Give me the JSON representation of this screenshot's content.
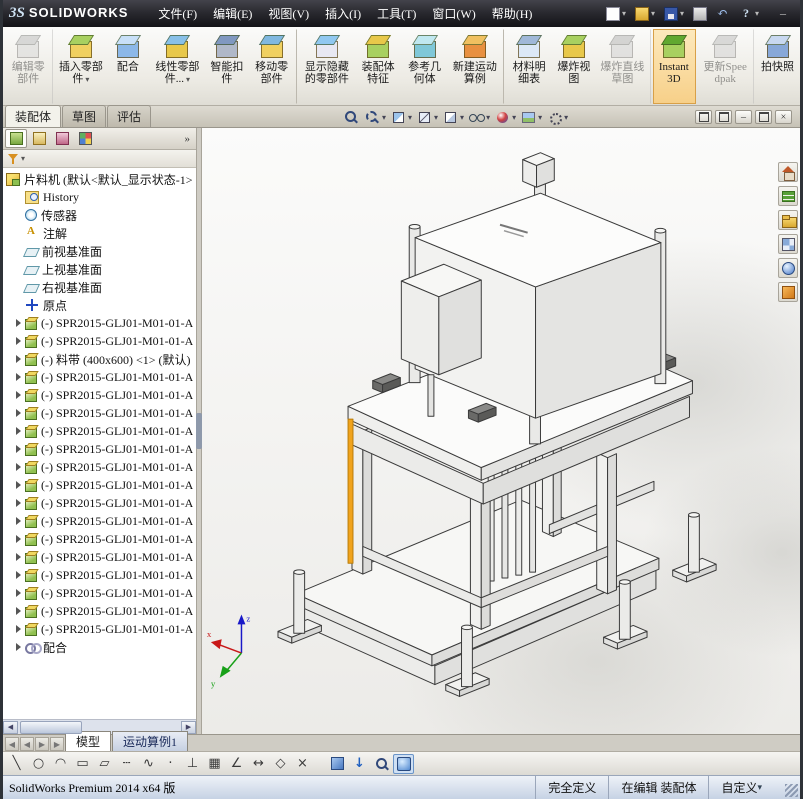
{
  "titlebar": {
    "logo_mark": "3S",
    "logo_text": "SOLIDWORKS",
    "menus": [
      "文件(F)",
      "编辑(E)",
      "视图(V)",
      "插入(I)",
      "工具(T)",
      "窗口(W)",
      "帮助(H)"
    ],
    "quick_icons": [
      {
        "icon": "new-document",
        "dropdown": true
      },
      {
        "icon": "open",
        "dropdown": true
      },
      {
        "icon": "save",
        "dropdown": true
      },
      {
        "icon": "print"
      },
      {
        "icon": "undo"
      },
      {
        "icon": "help",
        "dropdown": true
      }
    ],
    "window_dash": "–"
  },
  "ribbon": {
    "buttons": [
      {
        "label": "编辑零部件",
        "icon": "edit-component",
        "disabled": true,
        "sep": true
      },
      {
        "label": "插入零部件",
        "icon": "insert-component",
        "dropdown": true
      },
      {
        "label": "配合",
        "icon": "mate"
      },
      {
        "label": "线性零部件...",
        "icon": "linear-pattern",
        "dropdown": true
      },
      {
        "label": "智能扣件",
        "icon": "smart-fastener"
      },
      {
        "label": "移动零部件",
        "icon": "move-component",
        "sep": true
      },
      {
        "label": "显示隐藏的零部件",
        "icon": "show-hidden"
      },
      {
        "label": "装配体特征",
        "icon": "assembly-features"
      },
      {
        "label": "参考几何体",
        "icon": "reference-geometry"
      },
      {
        "label": "新建运动算例",
        "icon": "motion-study",
        "sep": true
      },
      {
        "label": "材料明细表",
        "icon": "bom"
      },
      {
        "label": "爆炸视图",
        "icon": "exploded-view"
      },
      {
        "label": "爆炸直线草图",
        "icon": "explode-sketch",
        "disabled": true,
        "sep": true
      },
      {
        "label": "Instant3D",
        "icon": "instant3d",
        "active": true,
        "sep": true
      },
      {
        "label": "更新Speedpak",
        "icon": "update-speedpak",
        "disabled": true,
        "sep": true
      },
      {
        "label": "拍快照",
        "icon": "snapshot"
      }
    ]
  },
  "doc_tabs": {
    "items": [
      {
        "label": "装配体",
        "active": true
      },
      {
        "label": "草图"
      },
      {
        "label": "评估"
      }
    ]
  },
  "view_toolbar": {
    "icons": [
      {
        "icon": "zoom-fit"
      },
      {
        "icon": "zoom-area",
        "dropdown": true
      },
      {
        "icon": "section-view",
        "dropdown": true
      },
      {
        "icon": "view-orientation",
        "dropdown": true
      },
      {
        "icon": "display-style",
        "dropdown": true
      },
      {
        "icon": "hide-show-items",
        "dropdown": true
      },
      {
        "icon": "edit-appearance",
        "dropdown": true
      },
      {
        "icon": "apply-scene",
        "dropdown": true
      },
      {
        "icon": "view-settings",
        "dropdown": true
      }
    ]
  },
  "child_window": {
    "controls": [
      {
        "icon": "window-restore",
        "box": true
      },
      {
        "icon": "window-float",
        "box": true
      },
      {
        "icon": "window-minimize",
        "glyph": "–"
      },
      {
        "icon": "window-maximize",
        "box": true
      },
      {
        "icon": "window-close",
        "glyph": "×"
      }
    ]
  },
  "panel": {
    "tabs": [
      {
        "icon": "feature-manager",
        "active": true
      },
      {
        "icon": "property-manager"
      },
      {
        "icon": "configuration-manager"
      },
      {
        "icon": "display-manager"
      }
    ],
    "overflow_glyph": "»",
    "filter_caret": "▾"
  },
  "tree": {
    "root": {
      "icon": "assembly",
      "label": "片料机 (默认<默认_显示状态-1>"
    },
    "items": [
      {
        "icon": "history",
        "label": "History"
      },
      {
        "icon": "sensors",
        "label": "传感器"
      },
      {
        "icon": "annotations",
        "label": "注解"
      },
      {
        "icon": "plane",
        "label": "前视基准面"
      },
      {
        "icon": "plane",
        "label": "上视基准面"
      },
      {
        "icon": "plane",
        "label": "右视基准面"
      },
      {
        "icon": "origin",
        "label": "原点"
      },
      {
        "icon": "component",
        "label": "(-) SPR2015-GLJ01-M01-01-A",
        "expand": true
      },
      {
        "icon": "component",
        "label": "(-) SPR2015-GLJ01-M01-01-A",
        "expand": true
      },
      {
        "icon": "component",
        "label": "(-) 料带 (400x600) <1> (默认)",
        "expand": true
      },
      {
        "icon": "component",
        "label": "(-) SPR2015-GLJ01-M01-01-A",
        "expand": true
      },
      {
        "icon": "component",
        "label": "(-) SPR2015-GLJ01-M01-01-A",
        "expand": true
      },
      {
        "icon": "component",
        "label": "(-) SPR2015-GLJ01-M01-01-A",
        "expand": true
      },
      {
        "icon": "component",
        "label": "(-) SPR2015-GLJ01-M01-01-A",
        "expand": true
      },
      {
        "icon": "component",
        "label": "(-) SPR2015-GLJ01-M01-01-A",
        "expand": true
      },
      {
        "icon": "component",
        "label": "(-) SPR2015-GLJ01-M01-01-A",
        "expand": true
      },
      {
        "icon": "component",
        "label": "(-) SPR2015-GLJ01-M01-01-A",
        "expand": true
      },
      {
        "icon": "component",
        "label": "(-) SPR2015-GLJ01-M01-01-A",
        "expand": true
      },
      {
        "icon": "component",
        "label": "(-) SPR2015-GLJ01-M01-01-A",
        "expand": true
      },
      {
        "icon": "component",
        "label": "(-) SPR2015-GLJ01-M01-01-A",
        "expand": true
      },
      {
        "icon": "component",
        "label": "(-) SPR2015-GLJ01-M01-01-A",
        "expand": true
      },
      {
        "icon": "component",
        "label": "(-) SPR2015-GLJ01-M01-01-A",
        "expand": true
      },
      {
        "icon": "component",
        "label": "(-) SPR2015-GLJ01-M01-01-A",
        "expand": true
      },
      {
        "icon": "component",
        "label": "(-) SPR2015-GLJ01-M01-01-A",
        "expand": true
      },
      {
        "icon": "component",
        "label": "(-) SPR2015-GLJ01-M01-01-A",
        "expand": true
      },
      {
        "icon": "mates",
        "label": "配合",
        "expand": true
      }
    ]
  },
  "viewport": {
    "triad": {
      "x": "x",
      "y": "y",
      "z": "z"
    }
  },
  "bottom_tabs": {
    "scroll_icons": [
      {
        "icon": "tab-scroll-first",
        "glyph": "◀"
      },
      {
        "icon": "tab-scroll-prev",
        "glyph": "◀"
      },
      {
        "icon": "tab-scroll-next",
        "glyph": "▶"
      },
      {
        "icon": "tab-scroll-last",
        "glyph": "▶"
      }
    ],
    "tabs": [
      {
        "label": "模型",
        "active": true
      },
      {
        "label": "运动算例1",
        "motion": true
      }
    ]
  },
  "bottom_toolbar": {
    "icons": [
      {
        "icon": "line",
        "glyph": "╲"
      },
      {
        "icon": "circle",
        "glyph": "○"
      },
      {
        "icon": "arc",
        "glyph": "◠"
      },
      {
        "icon": "rectangle",
        "glyph": "▭"
      },
      {
        "icon": "parallelogram",
        "glyph": "▱"
      },
      {
        "icon": "centerline",
        "glyph": "┄"
      },
      {
        "icon": "spline",
        "glyph": "∿"
      },
      {
        "icon": "point",
        "glyph": "·"
      },
      {
        "icon": "perpendicular",
        "glyph": "⊥"
      },
      {
        "icon": "grid",
        "glyph": "▦"
      },
      {
        "icon": "angle",
        "glyph": "∠"
      },
      {
        "icon": "dimension",
        "glyph": "↔"
      },
      {
        "icon": "polygon",
        "glyph": "◇"
      },
      {
        "icon": "trim",
        "glyph": "×",
        "sep": true
      },
      {
        "icon": "cube3d"
      },
      {
        "icon": "extrude",
        "glyph": "↓"
      },
      {
        "icon": "zoom-lens"
      },
      {
        "icon": "shaded-cube",
        "selected": true
      }
    ]
  },
  "statusbar": {
    "left": "SolidWorks Premium 2014 x64 版",
    "defined": "完全定义",
    "editing": "在编辑 装配体",
    "custom": "自定义"
  }
}
